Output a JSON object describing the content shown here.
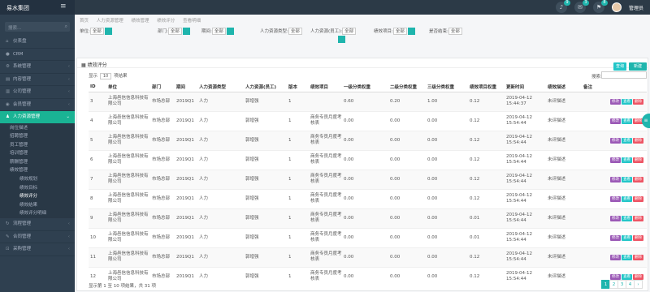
{
  "app": {
    "brand": "易水集团",
    "menu_icon": "hamburger-icon"
  },
  "topbar": {
    "icons": [
      {
        "name": "bell-icon",
        "badge": "9"
      },
      {
        "name": "mail-icon",
        "badge": "3"
      },
      {
        "name": "flag-icon",
        "badge": "8"
      }
    ],
    "user_name": "管理员"
  },
  "sidebar": {
    "search_placeholder": "搜索...",
    "items": [
      {
        "label": "仪表盘",
        "icon": "home-icon"
      },
      {
        "label": "CRM",
        "icon": "users-icon"
      },
      {
        "label": "系统管理",
        "icon": "gear-icon"
      },
      {
        "label": "内容管理",
        "icon": "file-icon"
      },
      {
        "label": "公司管理",
        "icon": "building-icon"
      },
      {
        "label": "会员管理",
        "icon": "user-icon"
      },
      {
        "label": "人力资源管理",
        "icon": "team-icon",
        "active": true
      }
    ],
    "subitems": [
      {
        "label": "岗位描述"
      },
      {
        "label": "招聘管理"
      },
      {
        "label": "员工管理"
      },
      {
        "label": "培训管理"
      },
      {
        "label": "薪酬管理"
      },
      {
        "label": "绩效管理"
      }
    ],
    "subsubitems": [
      {
        "label": "绩效规划"
      },
      {
        "label": "绩效目标"
      },
      {
        "label": "绩效评分",
        "current": true
      },
      {
        "label": "绩效结果"
      },
      {
        "label": "绩效评分明细"
      }
    ],
    "after": [
      {
        "label": "流程管理"
      },
      {
        "label": "合同管理"
      },
      {
        "label": "采购管理"
      }
    ]
  },
  "breadcrumb": [
    "首页",
    "人力资源管理",
    "绩效管理",
    "绩效评分",
    "查看明细"
  ],
  "filters": {
    "unit": {
      "label": "单位:",
      "value": "全部"
    },
    "dept": {
      "label": "部门:",
      "value": "全部"
    },
    "period": {
      "label": "期间:",
      "value": "全部"
    },
    "hr_type": {
      "label": "人力资源类型:",
      "value": "全部"
    },
    "hr_resource": {
      "label": "人力资源(员工):",
      "value": "全部"
    },
    "target": {
      "label": "绩效项目:",
      "value": "全部"
    },
    "finished": {
      "label": "是否结束:",
      "value": "全部"
    }
  },
  "panel": {
    "title": "绩效评分",
    "query_label": "查询",
    "new_label": "新建",
    "show_prefix": "显示",
    "page_size": "10",
    "show_suffix": "项结果",
    "search_label": "搜索:",
    "footer": "显示第 1 至 10 项结果，共 31 项"
  },
  "table": {
    "headers": [
      "ID",
      "单位",
      "部门",
      "期间",
      "人力资源类型",
      "人力资源(员工)",
      "版本",
      "绩效项目",
      "一级分类权重",
      "二级分类权重",
      "三级分类权重",
      "绩效项目权重",
      "更新时间",
      "绩效描述",
      "备注",
      ""
    ],
    "rows": [
      {
        "cells": [
          "3",
          "上海邑信信息科技有限公司",
          "市场总部",
          "2019Q1",
          "人力",
          "郭增强",
          "1",
          "",
          "0.60",
          "0.20",
          "1.00",
          "0.12",
          "2019-04-12 15:44:37",
          "未评描述",
          ""
        ]
      },
      {
        "cells": [
          "4",
          "上海邑信信息科技有限公司",
          "市场总部",
          "2019Q1",
          "人力",
          "郭增强",
          "1",
          "商务专员月度考核表",
          "0.00",
          "0.00",
          "0.00",
          "0.12",
          "2019-04-12 15:54:44",
          "未评描述",
          ""
        ]
      },
      {
        "cells": [
          "5",
          "上海邑信信息科技有限公司",
          "市场总部",
          "2019Q1",
          "人力",
          "郭增强",
          "1",
          "商务专员月度考核表",
          "0.00",
          "0.00",
          "0.00",
          "0.12",
          "2019-04-12 15:54:44",
          "未评描述",
          ""
        ]
      },
      {
        "cells": [
          "6",
          "上海邑信信息科技有限公司",
          "市场总部",
          "2019Q1",
          "人力",
          "郭增强",
          "1",
          "商务专员月度考核表",
          "0.00",
          "0.00",
          "0.00",
          "0.12",
          "2019-04-12 15:54:44",
          "未评描述",
          ""
        ]
      },
      {
        "cells": [
          "7",
          "上海邑信信息科技有限公司",
          "市场总部",
          "2019Q1",
          "人力",
          "郭增强",
          "1",
          "商务专员月度考核表",
          "0.00",
          "0.00",
          "0.00",
          "0.12",
          "2019-04-12 15:54:44",
          "未评描述",
          ""
        ]
      },
      {
        "cells": [
          "8",
          "上海邑信信息科技有限公司",
          "市场总部",
          "2019Q1",
          "人力",
          "郭增强",
          "1",
          "商务专员月度考核表",
          "0.00",
          "0.00",
          "0.00",
          "0.12",
          "2019-04-12 15:54:44",
          "未评描述",
          ""
        ]
      },
      {
        "cells": [
          "9",
          "上海邑信信息科技有限公司",
          "市场总部",
          "2019Q1",
          "人力",
          "郭增强",
          "1",
          "商务专员月度考核表",
          "0.00",
          "0.00",
          "0.00",
          "0.01",
          "2019-04-12 15:54:44",
          "未评描述",
          ""
        ]
      },
      {
        "cells": [
          "10",
          "上海邑信信息科技有限公司",
          "市场总部",
          "2019Q1",
          "人力",
          "郭增强",
          "1",
          "商务专员月度考核表",
          "0.00",
          "0.00",
          "0.00",
          "0.01",
          "2019-04-12 15:54:44",
          "未评描述",
          ""
        ]
      },
      {
        "cells": [
          "11",
          "上海邑信信息科技有限公司",
          "市场总部",
          "2019Q1",
          "人力",
          "郭增强",
          "1",
          "商务专员月度考核表",
          "0.00",
          "0.00",
          "0.00",
          "0.12",
          "2019-04-12 15:54:44",
          "未评描述",
          ""
        ]
      },
      {
        "cells": [
          "12",
          "上海邑信信息科技有限公司",
          "市场总部",
          "2019Q1",
          "人力",
          "郭增强",
          "1",
          "商务专员月度考核表",
          "0.00",
          "0.00",
          "0.00",
          "0.12",
          "2019-04-12 15:54:44",
          "未评描述",
          ""
        ]
      }
    ],
    "actions": {
      "edit": "修改",
      "detail": "查看",
      "delete": "删除"
    }
  },
  "pager": [
    "1",
    "2",
    "3",
    "4",
    "›"
  ],
  "colors": {
    "accent": "#1fb5ad",
    "sidebar": "#2f4050",
    "topbar": "#2c3a47"
  }
}
